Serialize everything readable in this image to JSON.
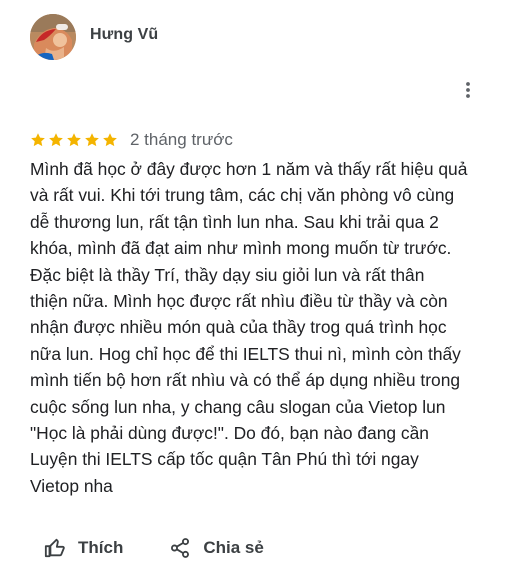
{
  "review": {
    "author": "Hưng Vũ",
    "rating": 5,
    "time": "2 tháng trước",
    "text": "Mình đã học ở đây được hơn 1 năm và thấy rất hiệu quả\nvà rất vui. Khi tới trung tâm, các chị văn phòng vô cùng\ndễ thương lun, rất tận tình lun nha. Sau khi trải qua 2\nkhóa, mình đã đạt aim như mình mong muốn từ trước.\nĐặc biệt là thầy Trí, thầy dạy siu giỏi lun và rất thân\nthiện nữa. Mình học được rất nhìu điều từ thầy và còn\nnhận được nhiều món quà của thầy trog quá trình học\nnữa lun. Hog chỉ học để thi IELTS thui nì, mình còn thấy\nmình tiến bộ hơn rất nhìu và có thể áp dụng nhiều trong\ncuộc sống lun nha, y chang câu slogan của Vietop lun\n\"Học là phải dùng được!\". Do đó, bạn nào đang cần\nLuyện thi IELTS cấp tốc quận Tân Phú thì tới ngay\nVietop nha"
  },
  "actions": {
    "like_label": "Thích",
    "share_label": "Chia sẻ"
  },
  "icons": {
    "star": "star-icon",
    "more": "more-vert-icon",
    "like": "thumb-up-icon",
    "share": "share-icon"
  },
  "colors": {
    "star": "#f4b400",
    "text": "#202124",
    "secondary_text": "#5f6368",
    "icon": "#3c4043"
  }
}
